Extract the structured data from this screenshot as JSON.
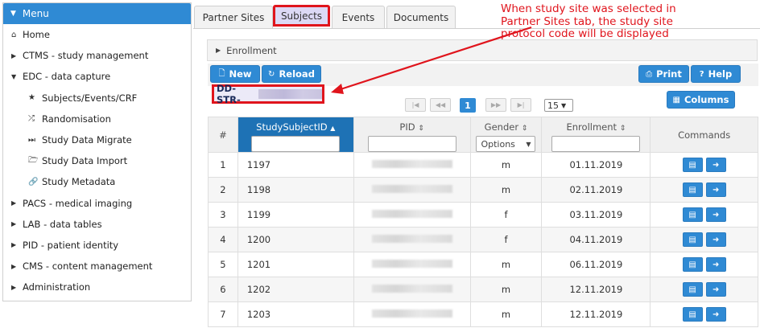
{
  "sidebar": {
    "header": "Menu",
    "items": [
      {
        "label": "Home",
        "icon": "home-icon",
        "glyph": "⌂",
        "sub": false
      },
      {
        "label": "CTMS - study management",
        "icon": "caret-right-icon",
        "glyph": "▶",
        "sub": false
      },
      {
        "label": "EDC - data capture",
        "icon": "caret-down-icon",
        "glyph": "▼",
        "sub": false
      },
      {
        "label": "Subjects/Events/CRF",
        "icon": "star-icon",
        "glyph": "★",
        "sub": true
      },
      {
        "label": "Randomisation",
        "icon": "shuffle-icon",
        "glyph": "⤮",
        "sub": true
      },
      {
        "label": "Study Data Migrate",
        "icon": "step-forward-icon",
        "glyph": "⏭",
        "sub": true
      },
      {
        "label": "Study Data Import",
        "icon": "folder-open-icon",
        "glyph": "🗁",
        "sub": true
      },
      {
        "label": "Study Metadata",
        "icon": "link-icon",
        "glyph": "🔗",
        "sub": true
      },
      {
        "label": "PACS - medical imaging",
        "icon": "caret-right-icon",
        "glyph": "▶",
        "sub": false
      },
      {
        "label": "LAB - data tables",
        "icon": "caret-right-icon",
        "glyph": "▶",
        "sub": false
      },
      {
        "label": "PID - patient identity",
        "icon": "caret-right-icon",
        "glyph": "▶",
        "sub": false
      },
      {
        "label": "CMS - content management",
        "icon": "caret-right-icon",
        "glyph": "▶",
        "sub": false
      },
      {
        "label": "Administration",
        "icon": "caret-right-icon",
        "glyph": "▶",
        "sub": false
      }
    ]
  },
  "tabs": [
    {
      "label": "Partner Sites",
      "active": false
    },
    {
      "label": "Subjects",
      "active": true
    },
    {
      "label": "Events",
      "active": false
    },
    {
      "label": "Documents",
      "active": false
    }
  ],
  "callout": {
    "text": "When study site was selected in\nPartner Sites tab, the study site\nprotocol code will be displayed"
  },
  "panel": {
    "title": "Enrollment"
  },
  "toolbar": {
    "new_label": "New",
    "reload_label": "Reload",
    "print_label": "Print",
    "help_label": "Help",
    "columns_label": "Columns"
  },
  "protocol_code": "DD-STR-",
  "pager": {
    "page": "1",
    "page_size": "15"
  },
  "table": {
    "headers": {
      "num": "#",
      "study_subject_id": "StudySubjectID",
      "pid": "PID",
      "gender": "Gender",
      "gender_filter": "Options",
      "enrollment": "Enrollment",
      "commands": "Commands"
    },
    "rows": [
      {
        "num": "1",
        "id": "1197",
        "gender": "m",
        "enrollment": "01.11.2019"
      },
      {
        "num": "2",
        "id": "1198",
        "gender": "m",
        "enrollment": "02.11.2019"
      },
      {
        "num": "3",
        "id": "1199",
        "gender": "f",
        "enrollment": "03.11.2019"
      },
      {
        "num": "4",
        "id": "1200",
        "gender": "f",
        "enrollment": "04.11.2019"
      },
      {
        "num": "5",
        "id": "1201",
        "gender": "m",
        "enrollment": "06.11.2019"
      },
      {
        "num": "6",
        "id": "1202",
        "gender": "m",
        "enrollment": "12.11.2019"
      },
      {
        "num": "7",
        "id": "1203",
        "gender": "m",
        "enrollment": "12.11.2019"
      }
    ]
  },
  "colors": {
    "accent": "#2f8ad4",
    "sorted_header": "#1e72b5",
    "highlight": "#e0141c"
  }
}
